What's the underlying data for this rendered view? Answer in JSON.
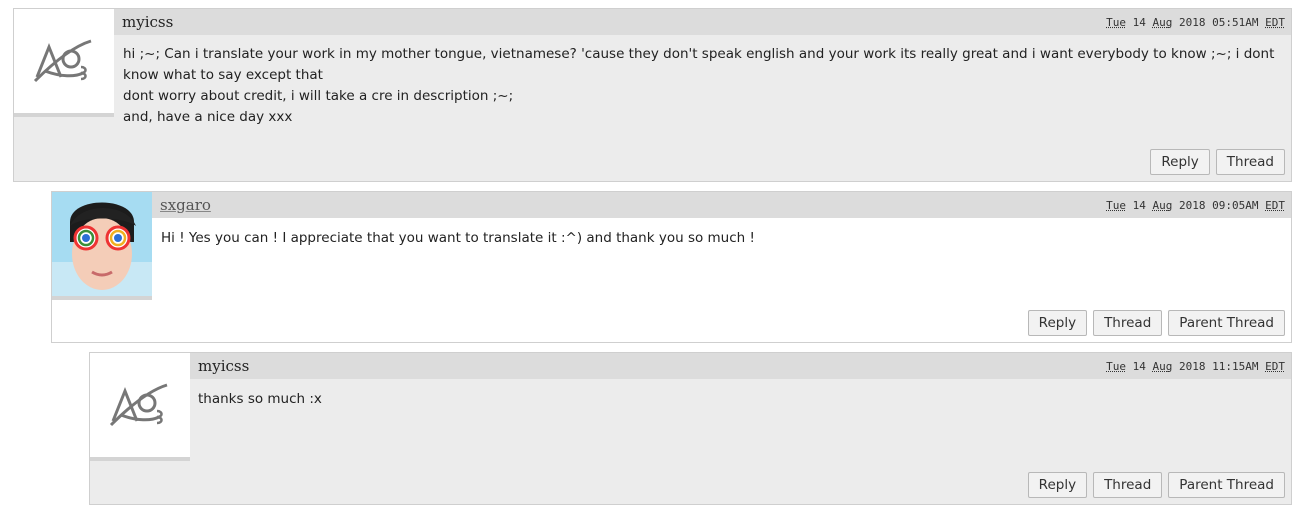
{
  "comments": [
    {
      "username": "myicss",
      "date": {
        "day": "Tue",
        "rest1": " 14 ",
        "month": "Aug",
        "rest2": " 2018 05:51AM ",
        "tz": "EDT"
      },
      "lines": [
        "hi ;~; Can i translate your work in my mother tongue, vietnamese? 'cause they don't speak english and your work its really great and i want everybody to know ;~; i dont know what to say except that",
        "dont worry about credit, i will take a cre in description ;~;",
        "and, have a nice day xxx"
      ],
      "actions": [
        "Reply",
        "Thread"
      ]
    },
    {
      "username": "sxgaro",
      "date": {
        "day": "Tue",
        "rest1": " 14 ",
        "month": "Aug",
        "rest2": " 2018 09:05AM ",
        "tz": "EDT"
      },
      "lines": [
        "Hi ! Yes you can ! I appreciate that you want to translate it :^) and thank you so much !"
      ],
      "actions": [
        "Reply",
        "Thread",
        "Parent Thread"
      ]
    },
    {
      "username": "myicss",
      "date": {
        "day": "Tue",
        "rest1": " 14 ",
        "month": "Aug",
        "rest2": " 2018 11:15AM ",
        "tz": "EDT"
      },
      "lines": [
        "thanks so much :x"
      ],
      "actions": [
        "Reply",
        "Thread",
        "Parent Thread"
      ]
    }
  ]
}
